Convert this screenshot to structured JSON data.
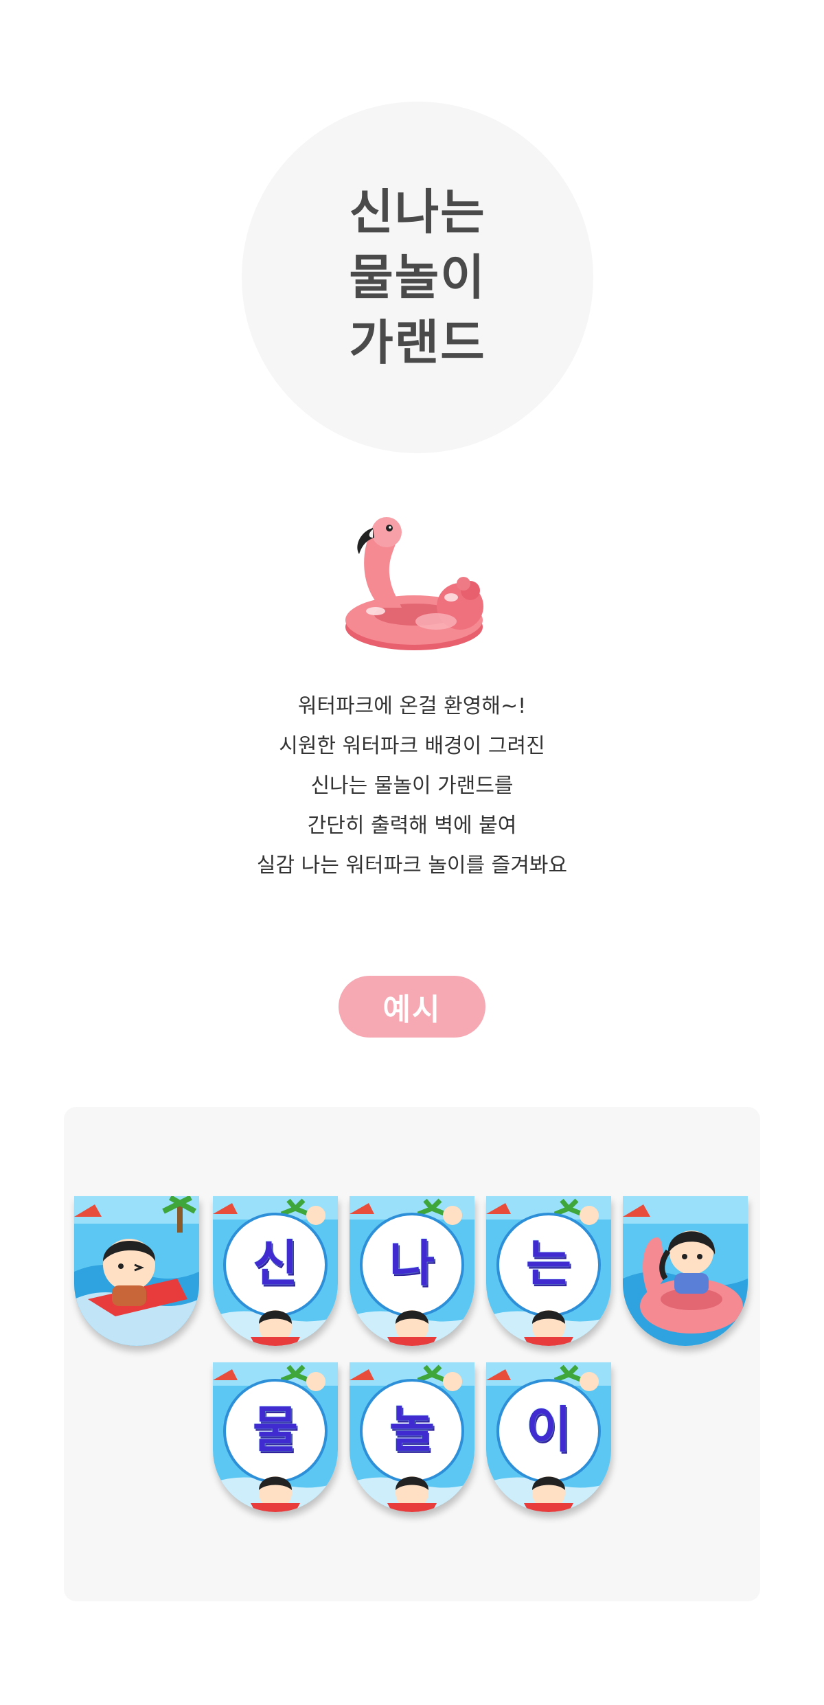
{
  "title": {
    "lines": [
      "신나는",
      "물놀이",
      "가랜드"
    ]
  },
  "intro": {
    "lines": [
      "워터파크에 온걸 환영해~!",
      "시원한 워터파크 배경이 그려진",
      "신나는 물놀이 가랜드를",
      "간단히 출력해 벽에 붙여",
      "실감 나는 워터파크 놀이를 즐겨봐요"
    ]
  },
  "badge": {
    "label": "예시"
  },
  "garland": {
    "row1": [
      {
        "type": "character-boy",
        "letter": ""
      },
      {
        "type": "letter",
        "letter": "신"
      },
      {
        "type": "letter",
        "letter": "나"
      },
      {
        "type": "letter",
        "letter": "는"
      },
      {
        "type": "character-girl",
        "letter": ""
      }
    ],
    "row2": [
      {
        "type": "letter",
        "letter": "물"
      },
      {
        "type": "letter",
        "letter": "놀"
      },
      {
        "type": "letter",
        "letter": "이"
      }
    ]
  },
  "colors": {
    "badge": "#f6a8b3",
    "panel": "#f7f7f7",
    "circle": "#f6f6f6",
    "title": "#4a4a4a"
  }
}
